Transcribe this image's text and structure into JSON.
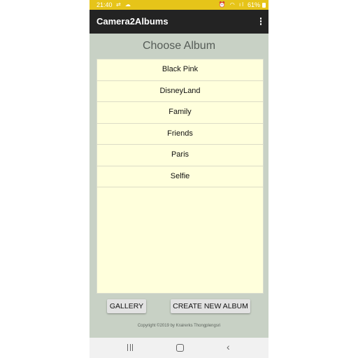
{
  "status_bar": {
    "time": "21:40",
    "left_icons": "⇄ ☁",
    "right_icons": "⏰ ◠ ıl",
    "battery": "61%",
    "color": "#e6c419"
  },
  "app_bar": {
    "title": "Camera2Albums",
    "menu_icon": "overflow-menu-icon",
    "color": "#232323"
  },
  "main": {
    "title": "Choose Album",
    "albums": [
      "Black Pink",
      "DisneyLand",
      "Family",
      "Friends",
      "Paris",
      "Selfie"
    ],
    "list_background": "#ffffdc",
    "gallery_label": "GALLERY",
    "create_label": "CREATE NEW ALBUM",
    "copyright": "Copyright ©2019 by Krairerks Thongplengsri"
  },
  "nav_bar": {
    "recent_icon": "recent-apps-icon",
    "home_icon": "home-icon",
    "back_icon": "back-icon",
    "back_glyph": "‹"
  }
}
